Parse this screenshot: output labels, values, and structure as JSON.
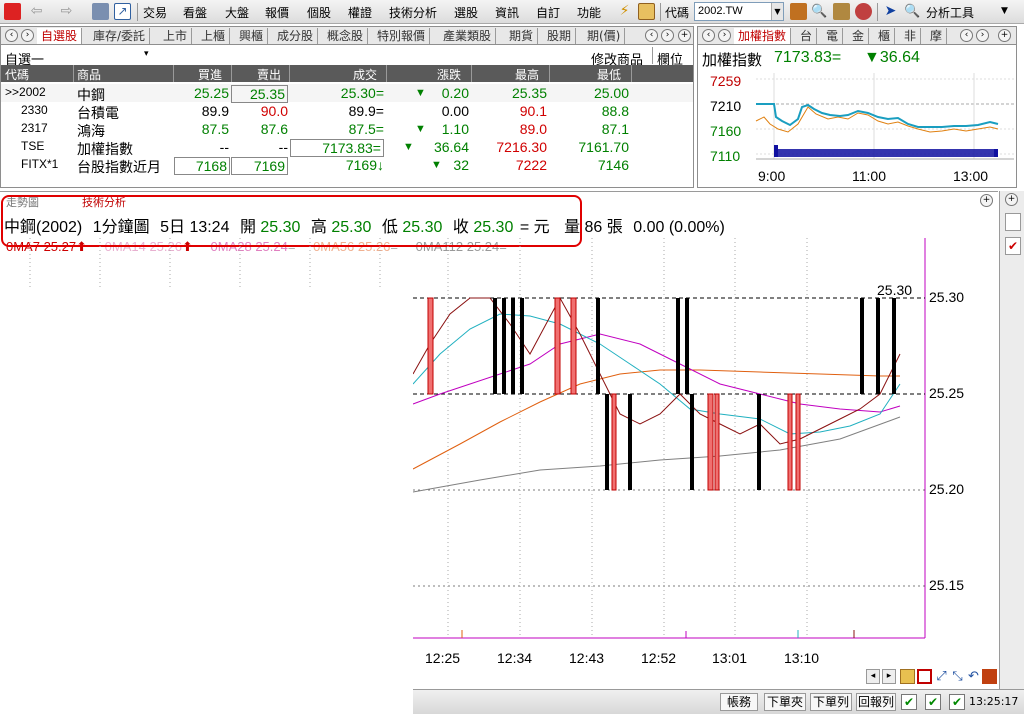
{
  "toolbar": {
    "menus": [
      "交易",
      "看盤",
      "大盤",
      "報價",
      "個股",
      "權證",
      "技術分析",
      "選股",
      "資訊",
      "自訂",
      "功能"
    ],
    "code_label": "代碼",
    "code_value": "2002.TW",
    "analysis_tools": "分析工具"
  },
  "watchlist": {
    "tabs": [
      "自選股",
      "庫存/委託",
      "上市",
      "上櫃",
      "興櫃",
      "成分股",
      "概念股",
      "特別報價",
      "產業類股",
      "期貨",
      "股期",
      "期(價)"
    ],
    "list_name": "自選一",
    "modify_button": "修改商品",
    "column_button": "欄位",
    "columns": [
      "代碼",
      "商品",
      "買進",
      "賣出",
      "成交",
      "漲跌",
      "最高",
      "最低"
    ],
    "rows": [
      {
        "code": ">>2002",
        "name": "中鋼",
        "bid": "25.25",
        "ask": "25.35",
        "last": "25.30=",
        "chg_sym": "▼",
        "chg": "0.20",
        "high": "25.35",
        "low": "25.00"
      },
      {
        "code": "2330",
        "name": "台積電",
        "bid": "89.9",
        "ask": "90.0",
        "last": "89.9=",
        "chg_sym": "",
        "chg": "0.00",
        "high": "90.1",
        "low": "88.8"
      },
      {
        "code": "2317",
        "name": "鴻海",
        "bid": "87.5",
        "ask": "87.6",
        "last": "87.5=",
        "chg_sym": "▼",
        "chg": "1.10",
        "high": "89.0",
        "low": "87.1"
      },
      {
        "code": "TSE",
        "name": "加權指數",
        "bid": "--",
        "ask": "--",
        "last": "7173.83=",
        "chg_sym": "▼",
        "chg": "36.64",
        "high": "7216.30",
        "low": "7161.70"
      },
      {
        "code": "FITX*1",
        "name": "台股指數近月",
        "bid": "7168",
        "ask": "7169",
        "last": "7169↓",
        "chg_sym": "▼",
        "chg": "32",
        "high": "7222",
        "low": "7146"
      }
    ]
  },
  "index_panel": {
    "tabs": [
      "加權指數",
      "台",
      "電",
      "金",
      "櫃",
      "非",
      "摩"
    ],
    "name": "加權指數",
    "value": "7173.83=",
    "change": "▼36.64",
    "y_ticks": [
      "7259",
      "7210",
      "7160",
      "7110"
    ],
    "x_ticks": [
      "9:00",
      "11:00",
      "13:00"
    ]
  },
  "chart": {
    "tabs": [
      "走勢圖",
      "技術分析"
    ],
    "info": {
      "stock": "中鋼(2002)",
      "period": "1分鐘圖",
      "range": "5日",
      "time": "13:24",
      "open_label": "開",
      "open": "25.30",
      "high_label": "高",
      "high": "25.30",
      "low_label": "低",
      "low": "25.30",
      "close_label": "收",
      "close": "25.30",
      "unit": "= 元",
      "vol_label": "量",
      "vol": "86",
      "vol_unit": "張",
      "change": "0.00 (0.00%)"
    },
    "ma": [
      "0MA7 25.27",
      "0MA14 25.26",
      "0MA28 25.24",
      "0MA56 25.26",
      "0MA112 25.24="
    ],
    "last_price_label": "25.30",
    "y_ticks": [
      "25.30",
      "25.25",
      "25.20",
      "25.15"
    ],
    "x_ticks": [
      "12:25",
      "12:34",
      "12:43",
      "12:52",
      "13:01",
      "13:10"
    ]
  },
  "status": {
    "buttons": [
      "帳務",
      "下單夾",
      "下單列",
      "回報列"
    ],
    "time": "13:25:17"
  }
}
